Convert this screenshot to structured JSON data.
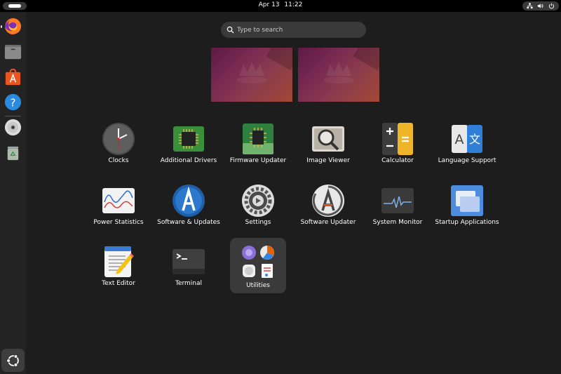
{
  "topbar": {
    "date": "Apr 13",
    "time": "11:22",
    "system_icons": [
      "network-icon",
      "volume-icon",
      "power-icon"
    ]
  },
  "dock": {
    "items": [
      "Firefox",
      "Files",
      "App Center",
      "Help",
      "Disc",
      "Trash"
    ],
    "apps_button": "Show Apps"
  },
  "search": {
    "placeholder": "Type to search"
  },
  "workspaces": [
    "Workspace 1",
    "Workspace 2"
  ],
  "apps": [
    {
      "label": "Clocks",
      "icon": "clock-icon"
    },
    {
      "label": "Additional Drivers",
      "icon": "chip-icon"
    },
    {
      "label": "Firmware Updater",
      "icon": "firmware-chip-icon"
    },
    {
      "label": "Image Viewer",
      "icon": "magnifier-icon"
    },
    {
      "label": "Calculator",
      "icon": "calculator-icon"
    },
    {
      "label": "Language Support",
      "icon": "language-icon"
    },
    {
      "label": "Power Statistics",
      "icon": "graph-icon"
    },
    {
      "label": "Software & Updates",
      "icon": "software-icon"
    },
    {
      "label": "Settings",
      "icon": "gear-icon"
    },
    {
      "label": "Software Updater",
      "icon": "updater-icon"
    },
    {
      "label": "System Monitor",
      "icon": "monitor-icon"
    },
    {
      "label": "Startup Applications",
      "icon": "startup-icon"
    },
    {
      "label": "Text Editor",
      "icon": "text-editor-icon"
    },
    {
      "label": "Terminal",
      "icon": "terminal-icon"
    },
    {
      "label": "Utilities",
      "icon": "folder-icon"
    }
  ],
  "colors": {
    "background": "#1d1d1d",
    "topbar": "#000000",
    "dock": "#232323",
    "accent": "#e95420"
  }
}
